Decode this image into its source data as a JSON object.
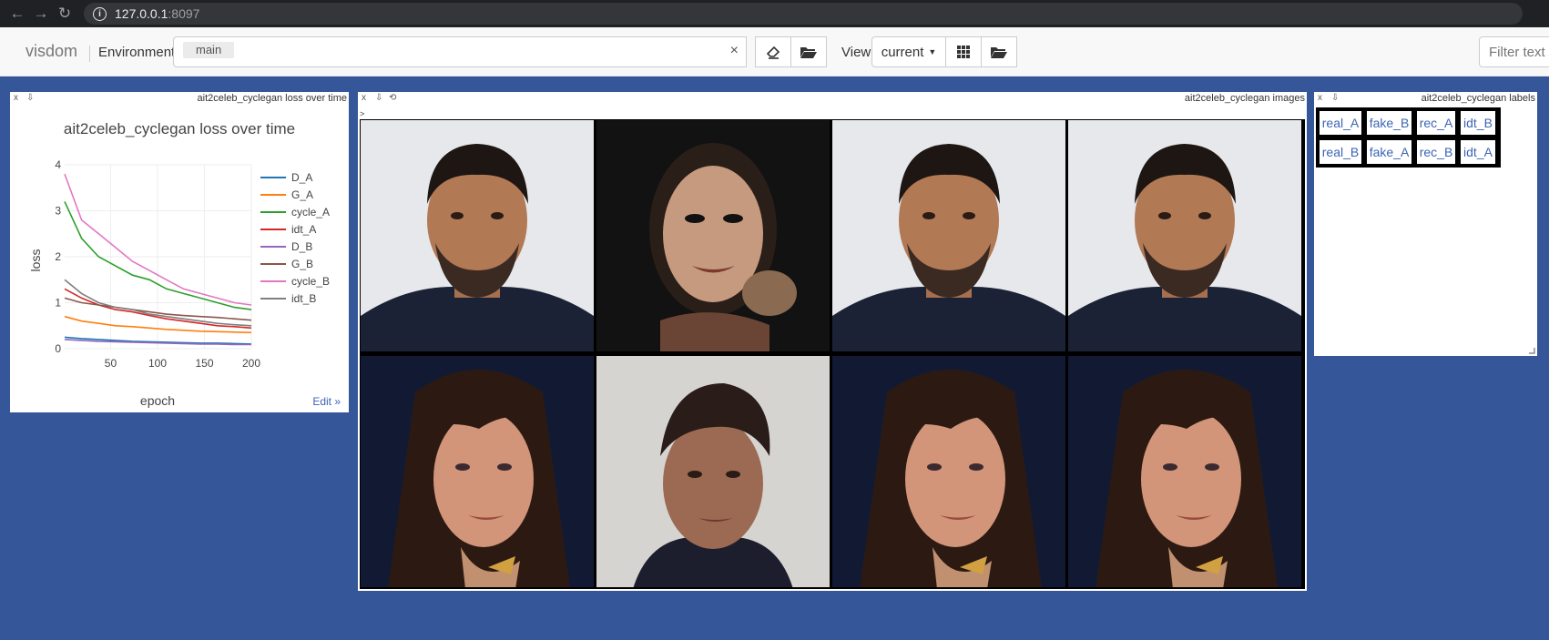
{
  "browser": {
    "url_host": "127.0.0.1",
    "url_port": ":8097"
  },
  "toolbar": {
    "brand": "visdom",
    "env_label": "Environment",
    "env_tag": "main",
    "env_clear": "×",
    "view_label": "View",
    "view_value": "current",
    "filter_placeholder": "Filter text"
  },
  "plot_pane": {
    "close": "x",
    "download": "⇩",
    "title": "ait2celeb_cyclegan loss over time",
    "edit_link": "Edit »"
  },
  "images_pane": {
    "close": "x",
    "download": "⇩",
    "reset": "⟲",
    "title": "ait2celeb_cyclegan images",
    "caret": ">"
  },
  "labels_pane": {
    "close": "x",
    "download": "⇩",
    "title": "ait2celeb_cyclegan labels",
    "rows": [
      [
        "real_A",
        "fake_B",
        "rec_A",
        "idt_B"
      ],
      [
        "real_B",
        "fake_A",
        "rec_B",
        "idt_A"
      ]
    ]
  },
  "chart_data": {
    "type": "line",
    "title": "ait2celeb_cyclegan loss over time",
    "xlabel": "epoch",
    "ylabel": "loss",
    "xlim": [
      1,
      200
    ],
    "ylim": [
      0,
      4
    ],
    "xticks": [
      50,
      100,
      150,
      200
    ],
    "yticks": [
      0,
      1,
      2,
      3,
      4
    ],
    "grid": true,
    "legend_position": "right",
    "series": [
      {
        "name": "D_A",
        "color": "#1f77b4",
        "values": [
          0.25,
          0.22,
          0.2,
          0.18,
          0.16,
          0.15,
          0.14,
          0.13,
          0.12,
          0.12,
          0.11,
          0.1
        ]
      },
      {
        "name": "G_A",
        "color": "#ff7f0e",
        "values": [
          0.7,
          0.6,
          0.55,
          0.5,
          0.48,
          0.45,
          0.42,
          0.4,
          0.38,
          0.37,
          0.36,
          0.35
        ]
      },
      {
        "name": "cycle_A",
        "color": "#2ca02c",
        "values": [
          3.2,
          2.4,
          2.0,
          1.8,
          1.6,
          1.5,
          1.3,
          1.2,
          1.1,
          1.0,
          0.9,
          0.85
        ]
      },
      {
        "name": "idt_A",
        "color": "#d62728",
        "values": [
          1.3,
          1.1,
          0.95,
          0.85,
          0.8,
          0.72,
          0.65,
          0.6,
          0.55,
          0.5,
          0.48,
          0.45
        ]
      },
      {
        "name": "D_B",
        "color": "#9467bd",
        "values": [
          0.2,
          0.18,
          0.16,
          0.15,
          0.14,
          0.13,
          0.12,
          0.11,
          0.1,
          0.1,
          0.09,
          0.09
        ]
      },
      {
        "name": "G_B",
        "color": "#8c564b",
        "values": [
          1.1,
          1.0,
          0.95,
          0.9,
          0.85,
          0.8,
          0.75,
          0.72,
          0.7,
          0.68,
          0.65,
          0.62
        ]
      },
      {
        "name": "cycle_B",
        "color": "#e377c2",
        "values": [
          3.8,
          2.8,
          2.5,
          2.2,
          1.9,
          1.7,
          1.5,
          1.3,
          1.2,
          1.1,
          1.0,
          0.95
        ]
      },
      {
        "name": "idt_B",
        "color": "#7f7f7f",
        "values": [
          1.5,
          1.2,
          1.0,
          0.9,
          0.85,
          0.75,
          0.7,
          0.65,
          0.6,
          0.55,
          0.52,
          0.5
        ]
      }
    ]
  }
}
